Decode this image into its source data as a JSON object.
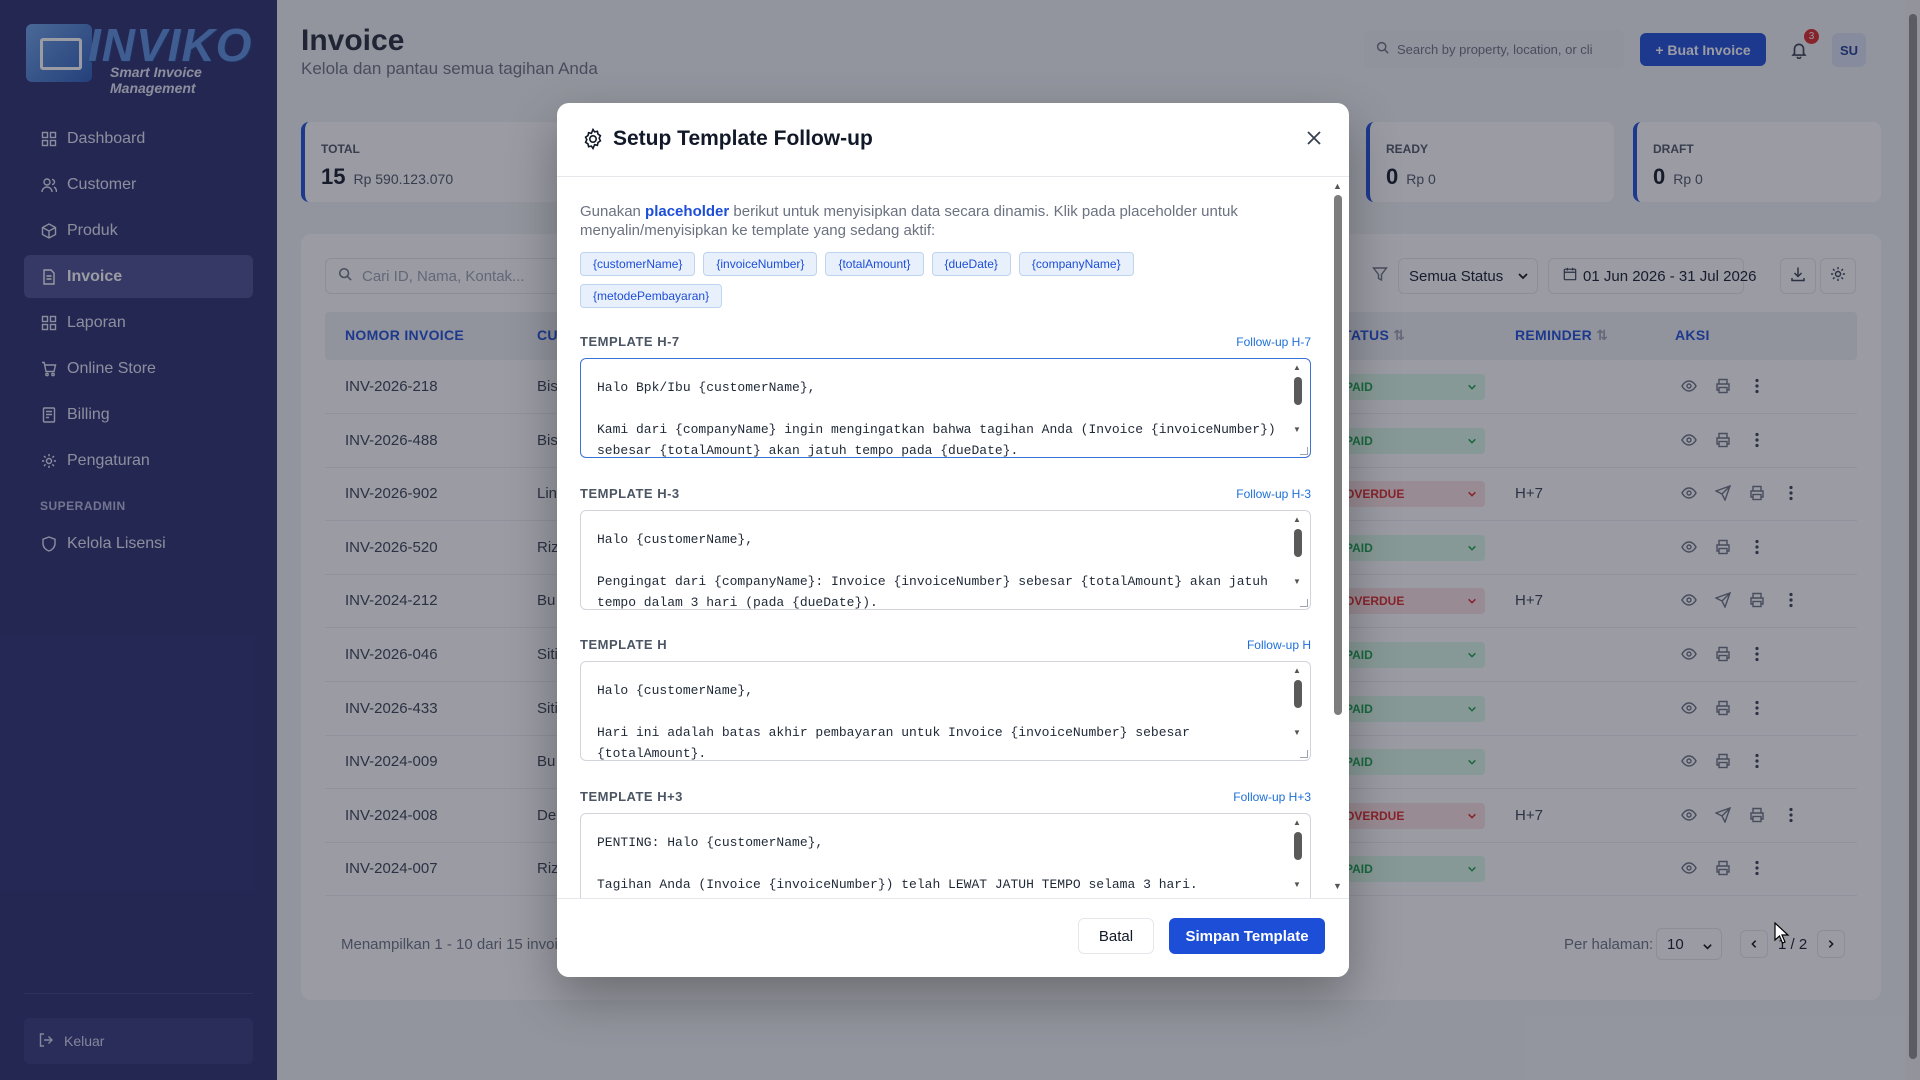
{
  "brand": {
    "name": "INVIKO",
    "tagline": "Smart Invoice Management"
  },
  "sidebar": {
    "items": [
      {
        "label": "Dashboard",
        "icon": "grid-icon"
      },
      {
        "label": "Customer",
        "icon": "users-icon"
      },
      {
        "label": "Produk",
        "icon": "box-icon"
      },
      {
        "label": "Invoice",
        "icon": "file-icon",
        "active": true
      },
      {
        "label": "Laporan",
        "icon": "grid-icon"
      },
      {
        "label": "Online Store",
        "icon": "cart-icon"
      },
      {
        "label": "Billing",
        "icon": "receipt-icon"
      },
      {
        "label": "Pengaturan",
        "icon": "gear-icon"
      }
    ],
    "section_label": "SUPERADMIN",
    "admin_items": [
      {
        "label": "Kelola Lisensi",
        "icon": "shield-icon"
      }
    ],
    "logout": "Keluar"
  },
  "header": {
    "title": "Invoice",
    "subtitle": "Kelola dan pantau semua tagihan Anda",
    "search_placeholder": "Search by property, location, or cli",
    "create_button": "+ Buat Invoice",
    "notif_count": "3",
    "avatar": "SU"
  },
  "stats": [
    {
      "label": "TOTAL",
      "count": "15",
      "amount": "Rp 590.123.070"
    },
    {
      "label": "READY",
      "count": "0",
      "amount": "Rp 0"
    },
    {
      "label": "DRAFT",
      "count": "0",
      "amount": "Rp 0"
    }
  ],
  "table": {
    "search_placeholder": "Cari ID, Nama, Kontak...",
    "status_filter": "Semua Status",
    "date_range": "01 Jun 2026 - 31 Jul 2026",
    "headers": {
      "invoice": "NOMOR INVOICE",
      "customer": "CU",
      "status": "TATUS",
      "reminder": "REMINDER",
      "action": "AKSI"
    },
    "rows": [
      {
        "id": "INV-2026-218",
        "customer": "Bis",
        "status": "PAID",
        "reminder": ""
      },
      {
        "id": "INV-2026-488",
        "customer": "Bis",
        "status": "PAID",
        "reminder": ""
      },
      {
        "id": "INV-2026-902",
        "customer": "Lin",
        "status": "OVERDUE",
        "reminder": "H+7"
      },
      {
        "id": "INV-2026-520",
        "customer": "Riz",
        "status": "PAID",
        "reminder": ""
      },
      {
        "id": "INV-2024-212",
        "customer": "Bu",
        "status": "OVERDUE",
        "reminder": "H+7"
      },
      {
        "id": "INV-2026-046",
        "customer": "Siti",
        "status": "PAID",
        "reminder": ""
      },
      {
        "id": "INV-2026-433",
        "customer": "Siti",
        "status": "PAID",
        "reminder": ""
      },
      {
        "id": "INV-2024-009",
        "customer": "Bu",
        "status": "PAID",
        "reminder": ""
      },
      {
        "id": "INV-2024-008",
        "customer": "De",
        "status": "OVERDUE",
        "reminder": "H+7"
      },
      {
        "id": "INV-2024-007",
        "customer": "Riz",
        "status": "PAID",
        "reminder": ""
      }
    ],
    "footer": "Menampilkan 1 - 10 dari 15 invoic",
    "per_page_label": "Per halaman:",
    "per_page_value": "10",
    "page": "1 / 2"
  },
  "modal": {
    "title": "Setup Template Follow-up",
    "intro_before": "Gunakan ",
    "intro_bold": "placeholder",
    "intro_after": " berikut untuk menyisipkan data secara dinamis. Klik pada placeholder untuk menyalin/menyisipkan ke template yang sedang aktif:",
    "placeholders": [
      "{customerName}",
      "{invoiceNumber}",
      "{totalAmount}",
      "{dueDate}",
      "{companyName}",
      "{metodePembayaran}"
    ],
    "templates": [
      {
        "label": "TEMPLATE H-7",
        "tag": "Follow-up H-7",
        "text": "Halo Bpk/Ibu {customerName},\n\nKami dari {companyName} ingin mengingatkan bahwa tagihan Anda (Invoice {invoiceNumber})\nsebesar {totalAmount} akan jatuh tempo pada {dueDate}."
      },
      {
        "label": "TEMPLATE H-3",
        "tag": "Follow-up H-3",
        "text": "Halo {customerName},\n\nPengingat dari {companyName}: Invoice {invoiceNumber} sebesar {totalAmount} akan jatuh\ntempo dalam 3 hari (pada {dueDate})."
      },
      {
        "label": "TEMPLATE H",
        "tag": "Follow-up H",
        "text": "Halo {customerName},\n\nHari ini adalah batas akhir pembayaran untuk Invoice {invoiceNumber} sebesar\n{totalAmount}."
      },
      {
        "label": "TEMPLATE H+3",
        "tag": "Follow-up H+3",
        "text": "PENTING: Halo {customerName},\n\nTagihan Anda (Invoice {invoiceNumber}) telah LEWAT JATUH TEMPO selama 3 hari."
      }
    ],
    "cancel": "Batal",
    "save": "Simpan Template"
  },
  "colors": {
    "sidebar": "#2b2d6e",
    "primary": "#1d4ed8",
    "paid": "#16a34a",
    "overdue": "#dc2626"
  }
}
